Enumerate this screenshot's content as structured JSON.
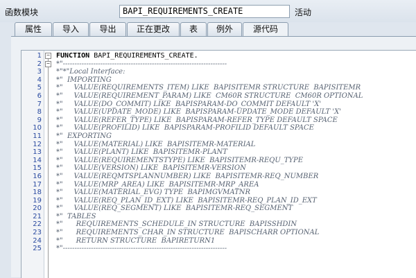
{
  "header": {
    "function_module_label": "函数模块",
    "function_module_name": "BAPI_REQUIREMENTS_CREATE",
    "status": "活动"
  },
  "tabs": [
    {
      "label": "属性",
      "active": false
    },
    {
      "label": "导入",
      "active": false
    },
    {
      "label": "导出",
      "active": false
    },
    {
      "label": "正在更改",
      "active": false
    },
    {
      "label": "表",
      "active": false
    },
    {
      "label": "例外",
      "active": false
    },
    {
      "label": "源代码",
      "active": true
    }
  ],
  "editor": {
    "lines": [
      {
        "num": "1",
        "keyword": "FUNCTION",
        "text": " BAPI_REQUIREMENTS_CREATE."
      },
      {
        "num": "2",
        "text": "*\"----------------------------------------------------------------------"
      },
      {
        "num": "3",
        "text": "*\"*\"Local Interface:"
      },
      {
        "num": "4",
        "text": "*\"  IMPORTING"
      },
      {
        "num": "5",
        "text": "*\"     VALUE(REQUIREMENTS_ITEM) LIKE  BAPISITEMR STRUCTURE  BAPISITEMR"
      },
      {
        "num": "6",
        "text": "*\"     VALUE(REQUIREMENT_PARAM) LIKE  CM60R STRUCTURE  CM60R OPTIONAL"
      },
      {
        "num": "7",
        "text": "*\"     VALUE(DO_COMMIT) LIKE  BAPISPARAM-DO_COMMIT DEFAULT 'X'"
      },
      {
        "num": "8",
        "text": "*\"     VALUE(UPDATE_MODE) LIKE  BAPISPARAM-UPDATE_MODE DEFAULT 'X'"
      },
      {
        "num": "9",
        "text": "*\"     VALUE(REFER_TYPE) LIKE  BAPISPARAM-REFER_TYPE DEFAULT SPACE"
      },
      {
        "num": "10",
        "text": "*\"     VALUE(PROFILID) LIKE  BAPISPARAM-PROFILID DEFAULT SPACE"
      },
      {
        "num": "11",
        "text": "*\"  EXPORTING"
      },
      {
        "num": "12",
        "text": "*\"     VALUE(MATERIAL) LIKE  BAPISITEMR-MATERIAL"
      },
      {
        "num": "13",
        "text": "*\"     VALUE(PLANT) LIKE  BAPISITEMR-PLANT"
      },
      {
        "num": "14",
        "text": "*\"     VALUE(REQUIREMENTSTYPE) LIKE  BAPISITEMR-REQU_TYPE"
      },
      {
        "num": "15",
        "text": "*\"     VALUE(VERSION) LIKE  BAPISITEMR-VERSION"
      },
      {
        "num": "16",
        "text": "*\"     VALUE(REQMTSPLANNUMBER) LIKE  BAPISITEMR-REQ_NUMBER"
      },
      {
        "num": "17",
        "text": "*\"     VALUE(MRP_AREA) LIKE  BAPISITEMR-MRP_AREA"
      },
      {
        "num": "18",
        "text": "*\"     VALUE(MATERIAL_EVG) TYPE  BAPIMGVMATNR"
      },
      {
        "num": "19",
        "text": "*\"     VALUE(REQ_PLAN_ID_EXT) LIKE  BAPISITEMR-REQ_PLAN_ID_EXT"
      },
      {
        "num": "20",
        "text": "*\"     VALUE(REQ_SEGMENT) LIKE  BAPISITEMR-REQ_SEGMENT"
      },
      {
        "num": "21",
        "text": "*\"  TABLES"
      },
      {
        "num": "22",
        "text": "*\"      REQUIREMENTS_SCHEDULE_IN STRUCTURE  BAPISSHDIN"
      },
      {
        "num": "23",
        "text": "*\"      REQUIREMENTS_CHAR_IN STRUCTURE  BAPISCHARR OPTIONAL"
      },
      {
        "num": "24",
        "text": "*\"      RETURN STRUCTURE  BAPIRETURN1"
      },
      {
        "num": "25",
        "text": "*\"----------------------------------------------------------------------"
      }
    ]
  }
}
